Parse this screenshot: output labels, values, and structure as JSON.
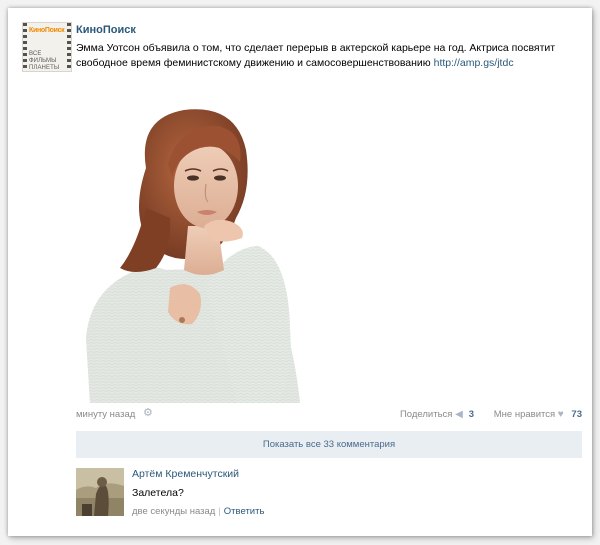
{
  "post": {
    "author": "КиноПоиск",
    "avatar_logo": "КиноПоиск",
    "avatar_tagline_lines": [
      "ВСЕ",
      "ФИЛЬМЫ",
      "ПЛАНЕТЫ"
    ],
    "text": "Эмма Уотсон объявила о том, что сделает перерыв в актерской карьере на год. Актриса посвятит свободное время феминистскому движению и самосовершенствованию",
    "link": "http://amp.gs/jtdc",
    "time": "минуту назад",
    "share_label": "Поделиться",
    "share_count": "3",
    "like_label": "Мне нравится",
    "like_count": "73"
  },
  "comments_bar": {
    "label": "Показать все 33 комментария"
  },
  "comment": {
    "author": "Артём Кременчутский",
    "text": "Залетела?",
    "time": "две секунды назад",
    "reply_label": "Ответить"
  },
  "icons": {
    "gear": "gear-icon",
    "share": "megaphone-icon",
    "like": "heart-icon"
  },
  "colors": {
    "link": "#2b587a",
    "meta": "#8a8a8a",
    "comments_bar_bg": "#e9eef3",
    "avatar_brand": "#f08a00"
  }
}
